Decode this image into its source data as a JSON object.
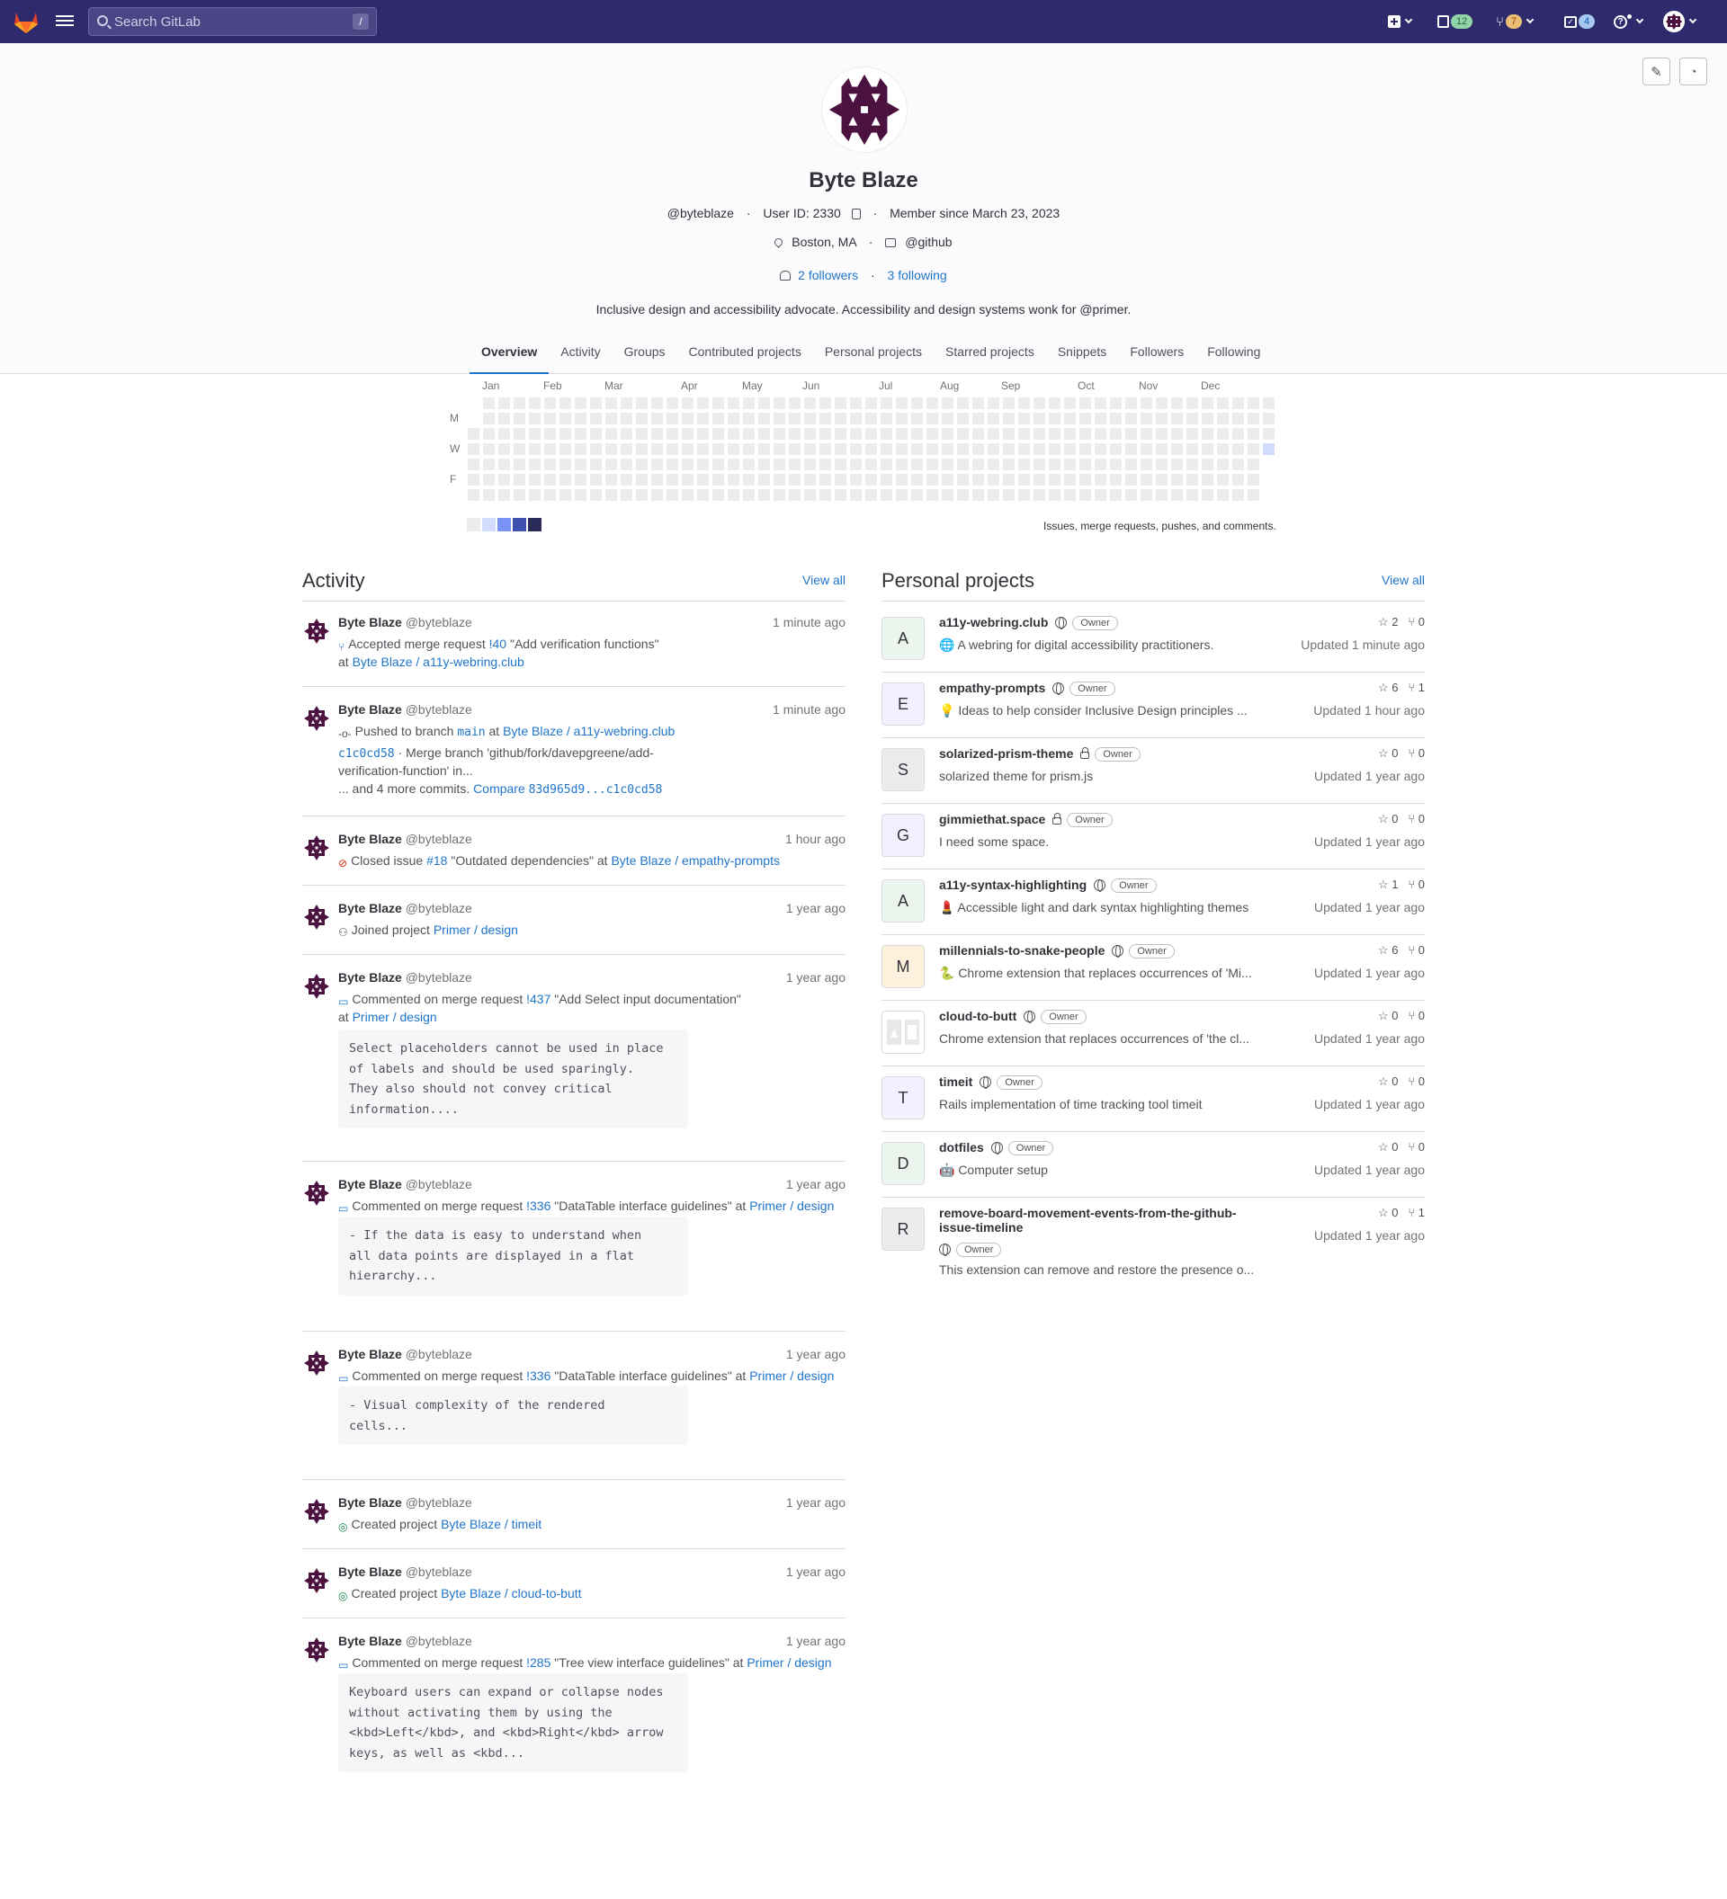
{
  "topbar": {
    "search_placeholder": "Search GitLab",
    "search_shortcut": "/",
    "issues_count": "12",
    "mr_count": "7",
    "todos_count": "4",
    "colors": {
      "bg": "#2f2a6b",
      "issues_pill": "#91d4a8",
      "mr_pill": "#e9be74",
      "todos_pill": "#a7c7f2"
    }
  },
  "profile": {
    "name": "Byte Blaze",
    "username": "@byteblaze",
    "user_id": "User ID: 2330",
    "member_since": "Member since March 23, 2023",
    "location": "Boston, MA",
    "org": "@github",
    "followers": "2 followers",
    "following": "3 following",
    "bio": "Inclusive design and accessibility advocate. Accessibility and design systems wonk for @primer."
  },
  "tabs": [
    "Overview",
    "Activity",
    "Groups",
    "Contributed projects",
    "Personal projects",
    "Starred projects",
    "Snippets",
    "Followers",
    "Following"
  ],
  "calendar": {
    "months": [
      "Jan",
      "Feb",
      "Mar",
      "Apr",
      "May",
      "Jun",
      "Jul",
      "Aug",
      "Sep",
      "Oct",
      "Nov",
      "Dec"
    ],
    "days": [
      "M",
      "W",
      "F"
    ],
    "caption": "Issues, merge requests, pushes, and comments.",
    "legend_colors": [
      "#ececef",
      "#d2dcff",
      "#7992f5",
      "#3f51ae",
      "#2a2b59"
    ]
  },
  "activity": {
    "title": "Activity",
    "view_all": "View all",
    "author": "Byte Blaze",
    "handle": "@byteblaze",
    "events": [
      {
        "time": "1 minute ago",
        "l1": [
          "Accepted merge request ",
          "!40",
          " \"Add verification functions\""
        ],
        "l2": [
          "at ",
          "Byte Blaze / a11y-webring.club"
        ]
      },
      {
        "time": "1 minute ago",
        "l1": [
          "Pushed to branch ",
          "main",
          " at ",
          "Byte Blaze / a11y-webring.club"
        ],
        "commit": "c1c0cd58",
        "commit_msg": " · Merge branch 'github/fork/davepgreene/add-",
        "commit_msg2": "verification-function' in...",
        "more": "... and 4 more commits. ",
        "compare": "Compare ",
        "range": "83d965d9...c1c0cd58"
      },
      {
        "time": "1 hour ago",
        "l1": [
          "Closed issue ",
          "#18",
          " \"Outdated dependencies\" at ",
          "Byte Blaze / empathy-prompts"
        ]
      },
      {
        "time": "1 year ago",
        "l1": [
          "Joined project ",
          "Primer / design"
        ]
      },
      {
        "time": "1 year ago",
        "l1": [
          "Commented on merge request ",
          "!437",
          " \"Add Select input documentation\""
        ],
        "l2": [
          "at ",
          "Primer / design"
        ],
        "note": "Select placeholders cannot be used in place\nof labels and should be used sparingly.\nThey also should not convey critical\ninformation...."
      },
      {
        "time": "1 year ago",
        "l1": [
          "Commented on merge request ",
          "!336",
          " \"DataTable interface guidelines\" at ",
          "Primer / design"
        ],
        "note": "- If the data is easy to understand when\nall data points are displayed in a flat\nhierarchy..."
      },
      {
        "time": "1 year ago",
        "l1": [
          "Commented on merge request ",
          "!336",
          " \"DataTable interface guidelines\" at ",
          "Primer / design"
        ],
        "note": "- Visual complexity of the rendered\ncells..."
      },
      {
        "time": "1 year ago",
        "l1": [
          "Created project ",
          "Byte Blaze / timeit"
        ]
      },
      {
        "time": "1 year ago",
        "l1": [
          "Created project ",
          "Byte Blaze / cloud-to-butt"
        ]
      },
      {
        "time": "1 year ago",
        "l1": [
          "Commented on merge request ",
          "!285",
          " \"Tree view interface guidelines\" at ",
          "Primer / design"
        ],
        "note": "Keyboard users can expand or collapse nodes\nwithout activating them by using the\n<kbd>Left</kbd>, and <kbd>Right</kbd> arrow\nkeys, as well as <kbd..."
      }
    ]
  },
  "projects": {
    "title": "Personal projects",
    "view_all": "View all",
    "owner_badge": "Owner",
    "items": [
      {
        "initial": "A",
        "name": "a11y-webring.club",
        "vis": "public",
        "desc": "🌐 A webring for digital accessibility practitioners.",
        "stars": "2",
        "forks": "0",
        "updated": "Updated 1 minute ago",
        "color": "#ecf4ee"
      },
      {
        "initial": "E",
        "name": "empathy-prompts",
        "vis": "public",
        "desc": "💡 Ideas to help consider Inclusive Design principles ...",
        "stars": "6",
        "forks": "1",
        "updated": "Updated 1 hour ago",
        "color": "#f4f0ff"
      },
      {
        "initial": "S",
        "name": "solarized-prism-theme",
        "vis": "private",
        "desc": "solarized theme for prism.js",
        "stars": "0",
        "forks": "0",
        "updated": "Updated 1 year ago",
        "color": "#ececef"
      },
      {
        "initial": "G",
        "name": "gimmiethat.space",
        "vis": "private",
        "desc": "I need some space.",
        "stars": "0",
        "forks": "0",
        "updated": "Updated 1 year ago",
        "color": "#f4f0ff"
      },
      {
        "initial": "A",
        "name": "a11y-syntax-highlighting",
        "vis": "public",
        "desc": "💄 Accessible light and dark syntax highlighting themes",
        "stars": "1",
        "forks": "0",
        "updated": "Updated 1 year ago",
        "color": "#ecf4ee"
      },
      {
        "initial": "M",
        "name": "millennials-to-snake-people",
        "vis": "public",
        "desc": "🐍 Chrome extension that replaces occurrences of 'Mi...",
        "stars": "6",
        "forks": "0",
        "updated": "Updated 1 year ago",
        "color": "#fdf1dd"
      },
      {
        "initial": "",
        "name": "cloud-to-butt",
        "vis": "public",
        "desc": "Chrome extension that replaces occurrences of 'the cl...",
        "stars": "0",
        "forks": "0",
        "updated": "Updated 1 year ago",
        "color": "#ffffff"
      },
      {
        "initial": "T",
        "name": "timeit",
        "vis": "public",
        "desc": "Rails implementation of time tracking tool timeit",
        "stars": "0",
        "forks": "0",
        "updated": "Updated 1 year ago",
        "color": "#f4f0ff"
      },
      {
        "initial": "D",
        "name": "dotfiles",
        "vis": "public",
        "desc": "🤖 Computer setup",
        "stars": "0",
        "forks": "0",
        "updated": "Updated 1 year ago",
        "color": "#ecf4ee"
      },
      {
        "initial": "R",
        "name": "remove-board-movement-events-from-the-github-",
        "name2": "issue-timeline",
        "vis": "public",
        "desc": "This extension can remove and restore the presence o...",
        "stars": "0",
        "forks": "1",
        "updated": "Updated 1 year ago",
        "color": "#ececef"
      }
    ]
  }
}
